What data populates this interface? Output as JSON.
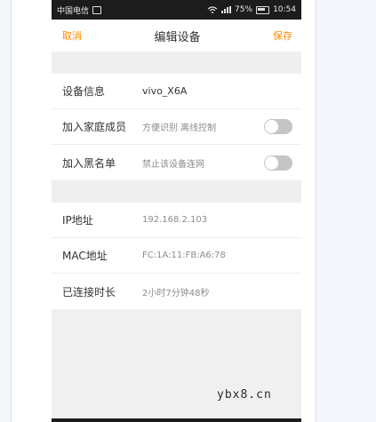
{
  "statusbar": {
    "carrier": "中国电信",
    "battery": "75%",
    "time": "10:54"
  },
  "navbar": {
    "cancel": "取消",
    "title": "编辑设备",
    "save": "保存"
  },
  "device": {
    "info_label": "设备信息",
    "info_value": "vivo_X6A",
    "family_label": "加入家庭成员",
    "family_hint": "方便识别 离线控制",
    "family_enabled": false,
    "blacklist_label": "加入黑名单",
    "blacklist_hint": "禁止该设备连网",
    "blacklist_enabled": false
  },
  "network": {
    "ip_label": "IP地址",
    "ip_value": "192.168.2.103",
    "mac_label": "MAC地址",
    "mac_value": "FC:1A:11:FB:A6:78",
    "duration_label": "已连接时长",
    "duration_value": "2小时7分钟48秒"
  },
  "watermark": "ybx8.cn"
}
